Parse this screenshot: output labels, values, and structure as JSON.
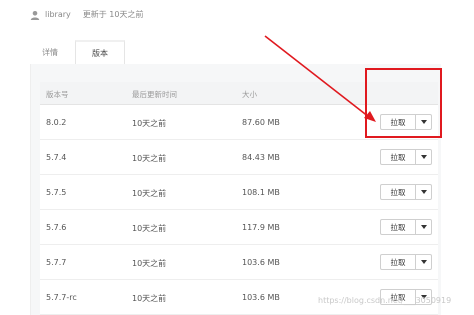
{
  "meta": {
    "user": "library",
    "updated": "更新于 10天之前"
  },
  "tabs": [
    {
      "label": "详情"
    },
    {
      "label": "版本"
    }
  ],
  "table": {
    "headers": [
      "版本号",
      "最后更新时间",
      "大小"
    ],
    "rows": [
      {
        "version": "8.0.2",
        "updated": "10天之前",
        "size": "87.60 MB",
        "action": "拉取"
      },
      {
        "version": "5.7.4",
        "updated": "10天之前",
        "size": "84.43 MB",
        "action": "拉取"
      },
      {
        "version": "5.7.5",
        "updated": "10天之前",
        "size": "108.1 MB",
        "action": "拉取"
      },
      {
        "version": "5.7.6",
        "updated": "10天之前",
        "size": "117.9 MB",
        "action": "拉取"
      },
      {
        "version": "5.7.7",
        "updated": "10天之前",
        "size": "103.6 MB",
        "action": "拉取"
      },
      {
        "version": "5.7.7-rc",
        "updated": "10天之前",
        "size": "103.6 MB",
        "action": "拉取"
      }
    ]
  },
  "annotation": {
    "color": "#e0191f"
  },
  "watermark": "https://blog.csdn.net/___3050919"
}
